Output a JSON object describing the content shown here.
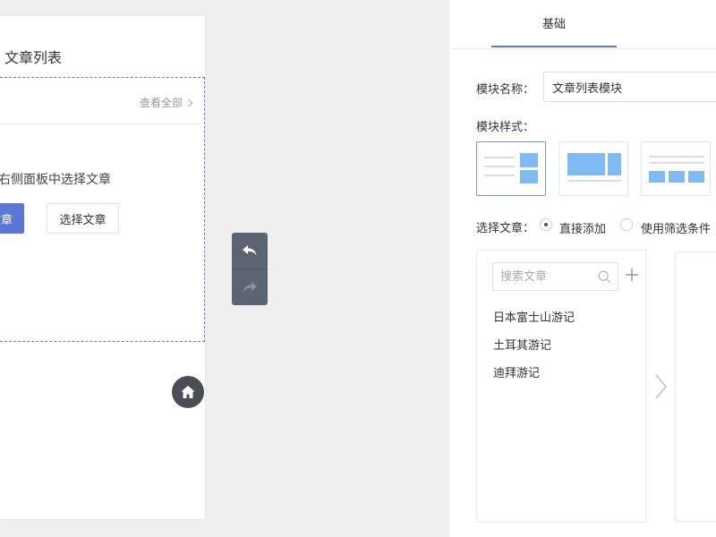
{
  "preview": {
    "title": "文章列表",
    "view_all": "查看全部",
    "hint": "右侧面板中选择文章",
    "primary_button": "文章",
    "secondary_button": "选择文章"
  },
  "panel": {
    "tab": "基础",
    "module_name_label": "模块名称：",
    "module_name_value": "文章列表模块",
    "module_style_label": "模块样式：",
    "select_article_label": "选择文章：",
    "radio_direct": "直接添加",
    "radio_filter": "使用筛选条件",
    "search_placeholder": "搜索文章",
    "articles": [
      "日本富士山游记",
      "土耳其游记",
      "迪拜游记"
    ]
  },
  "colors": {
    "accent": "#5a77d6",
    "style_block": "#7fbaf2",
    "undo_redo_bg": "#5b6470",
    "home_button_bg": "#4a4e54"
  },
  "icons": [
    "chevron-right-icon",
    "home-icon",
    "undo-icon",
    "redo-icon",
    "search-icon",
    "plus-icon",
    "chevron-right-icon"
  ]
}
